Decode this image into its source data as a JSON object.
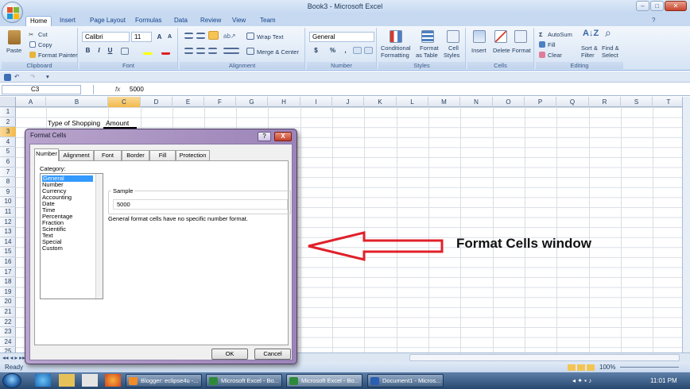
{
  "window": {
    "title": "Book3 - Microsoft Excel"
  },
  "ribbon_tabs": [
    "Home",
    "Insert",
    "Page Layout",
    "Formulas",
    "Data",
    "Review",
    "View",
    "Team"
  ],
  "clipboard": {
    "paste": "Paste",
    "cut": "Cut",
    "copy": "Copy",
    "format_painter": "Format Painter",
    "group": "Clipboard"
  },
  "font": {
    "name": "Calibri",
    "size": "11",
    "bold": "B",
    "italic": "I",
    "underline": "U",
    "grow": "A",
    "shrink": "A",
    "group": "Font"
  },
  "alignment": {
    "wrap": "Wrap Text",
    "merge": "Merge & Center",
    "group": "Alignment"
  },
  "number": {
    "format": "General",
    "currency": "$",
    "percent": "%",
    "comma": ",",
    "group": "Number"
  },
  "styles": {
    "conditional": "Conditional",
    "conditional2": "Formatting",
    "table": "Format",
    "table2": "as Table",
    "cell": "Cell",
    "cell2": "Styles",
    "group": "Styles"
  },
  "cells": {
    "insert": "Insert",
    "delete": "Delete",
    "format": "Format",
    "group": "Cells"
  },
  "editing": {
    "autosum": "AutoSum",
    "fill": "Fill",
    "clear": "Clear",
    "sort": "Sort &",
    "sort2": "Filter",
    "find": "Find &",
    "find2": "Select",
    "group": "Editing"
  },
  "formula_bar": {
    "name_box": "C3",
    "fx": "fx",
    "value": "5000"
  },
  "columns": [
    "A",
    "B",
    "C",
    "D",
    "E",
    "F",
    "G",
    "H",
    "I",
    "J",
    "K",
    "L",
    "M",
    "N",
    "O",
    "P",
    "Q",
    "R",
    "S",
    "T"
  ],
  "rows": [
    "1",
    "2",
    "3",
    "4",
    "5",
    "6",
    "7",
    "8",
    "9",
    "10",
    "11",
    "12",
    "13",
    "14",
    "15",
    "16",
    "17",
    "18",
    "19",
    "20",
    "21",
    "22",
    "23",
    "24",
    "25"
  ],
  "cells_data": {
    "b2": "Type of Shopping",
    "c2": "Amount"
  },
  "dialog": {
    "title": "Format Cells",
    "help": "?",
    "close": "X",
    "tabs": [
      "Number",
      "Alignment",
      "Font",
      "Border",
      "Fill",
      "Protection"
    ],
    "category_label": "Category:",
    "categories": [
      "General",
      "Number",
      "Currency",
      "Accounting",
      "Date",
      "Time",
      "Percentage",
      "Fraction",
      "Scientific",
      "Text",
      "Special",
      "Custom"
    ],
    "sample_label": "Sample",
    "sample_value": "5000",
    "description": "General format cells have no specific number format.",
    "ok": "OK",
    "cancel": "Cancel"
  },
  "annotation": {
    "text": "Format Cells window",
    "color": "#e0202a"
  },
  "status": {
    "ready": "Ready",
    "zoom": "100%"
  },
  "taskbar": {
    "items": [
      "Blogger: eclipse4u -...",
      "Microsoft Excel - Bo...",
      "Microsoft Excel - Bo...",
      "Document1 - Micros..."
    ],
    "time": "11:01 PM"
  }
}
